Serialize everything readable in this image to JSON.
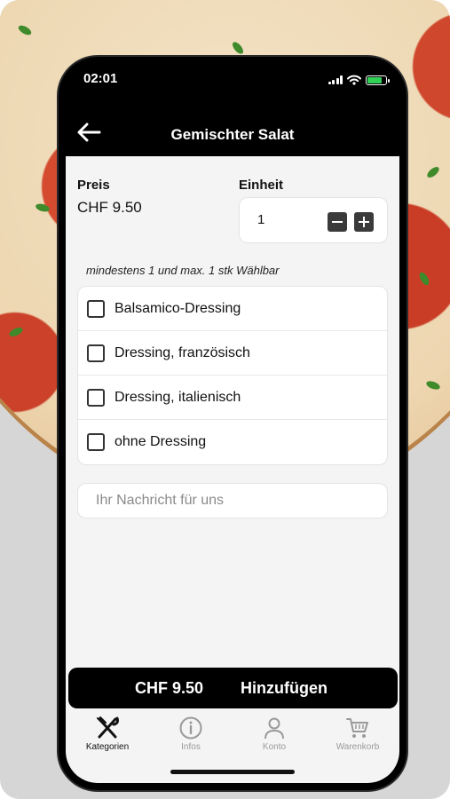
{
  "status_bar": {
    "time": "02:01"
  },
  "nav": {
    "title": "Gemischter Salat"
  },
  "product": {
    "price_label": "Preis",
    "price_value": "CHF 9.50",
    "unit_label": "Einheit",
    "quantity": "1"
  },
  "options": {
    "hint": "mindestens 1 und max. 1 stk Wählbar",
    "items": [
      {
        "label": "Balsamico-Dressing",
        "checked": false
      },
      {
        "label": "Dressing, französisch",
        "checked": false
      },
      {
        "label": "Dressing, italienisch",
        "checked": false
      },
      {
        "label": "ohne Dressing",
        "checked": false
      }
    ]
  },
  "message": {
    "placeholder": "Ihr Nachricht für uns",
    "value": ""
  },
  "cart_button": {
    "price": "CHF 9.50",
    "label": "Hinzufügen"
  },
  "tabs": [
    {
      "label": "Kategorien",
      "icon": "fork-knife-icon",
      "active": true
    },
    {
      "label": "Infos",
      "icon": "info-icon",
      "active": false
    },
    {
      "label": "Konto",
      "icon": "user-icon",
      "active": false
    },
    {
      "label": "Warenkorb",
      "icon": "cart-icon",
      "active": false
    }
  ],
  "colors": {
    "background": "#f4f4f4",
    "bar": "#000000",
    "button": "#3a3a3a",
    "battery": "#31d158",
    "inactive_tab": "#9a9a9a"
  }
}
